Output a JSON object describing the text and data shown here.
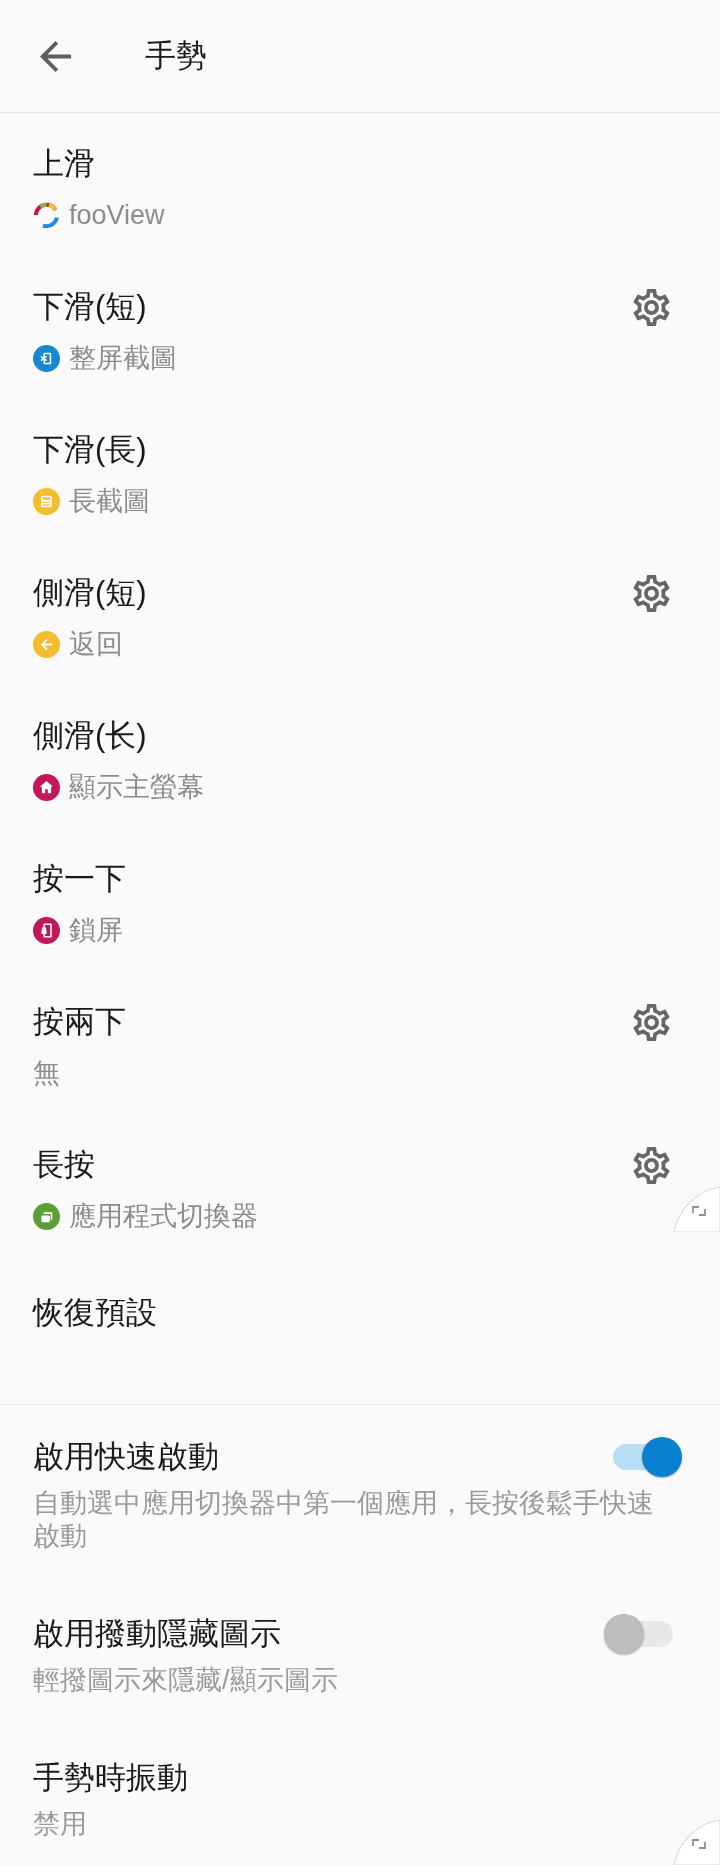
{
  "header": {
    "title": "手勢"
  },
  "gestures": [
    {
      "title": "上滑",
      "action": {
        "label": "fooView",
        "kind": "app"
      },
      "settings_button": false,
      "floating_handle": false
    },
    {
      "title": "下滑(短)",
      "action": {
        "label": "整屏截圖",
        "kind": "screenshot",
        "color": "#1787cf"
      },
      "settings_button": true,
      "floating_handle": false
    },
    {
      "title": "下滑(長)",
      "action": {
        "label": "長截圖",
        "kind": "long_screenshot",
        "color": "#f4bd2f"
      },
      "settings_button": false,
      "floating_handle": false
    },
    {
      "title": "側滑(短)",
      "action": {
        "label": "返回",
        "kind": "back",
        "color": "#f4bd2f"
      },
      "settings_button": true,
      "floating_handle": false
    },
    {
      "title": "側滑(长)",
      "action": {
        "label": "顯示主螢幕",
        "kind": "home",
        "color": "#c2185b"
      },
      "settings_button": false,
      "floating_handle": false
    },
    {
      "title": "按一下",
      "action": {
        "label": "鎖屏",
        "kind": "lock",
        "color": "#c2185b"
      },
      "settings_button": false,
      "floating_handle": false
    },
    {
      "title": "按兩下",
      "action": {
        "label": "無",
        "kind": "none"
      },
      "settings_button": true,
      "floating_handle": false
    },
    {
      "title": "長按",
      "action": {
        "label": "應用程式切換器",
        "kind": "switcher",
        "color": "#5b9f38"
      },
      "settings_button": true,
      "floating_handle": true
    }
  ],
  "reset": {
    "label": "恢復預設"
  },
  "options": [
    {
      "title": "啟用快速啟動",
      "description": "自動選中應用切換器中第一個應用，長按後鬆手快速啟動",
      "kind": "switch",
      "on": true,
      "floating_handle": false
    },
    {
      "title": "啟用撥動隱藏圖示",
      "description": "輕撥圖示來隱藏/顯示圖示",
      "kind": "switch",
      "on": false,
      "floating_handle": false
    },
    {
      "title": "手勢時振動",
      "description": "禁用",
      "kind": "value",
      "floating_handle": true
    }
  ]
}
